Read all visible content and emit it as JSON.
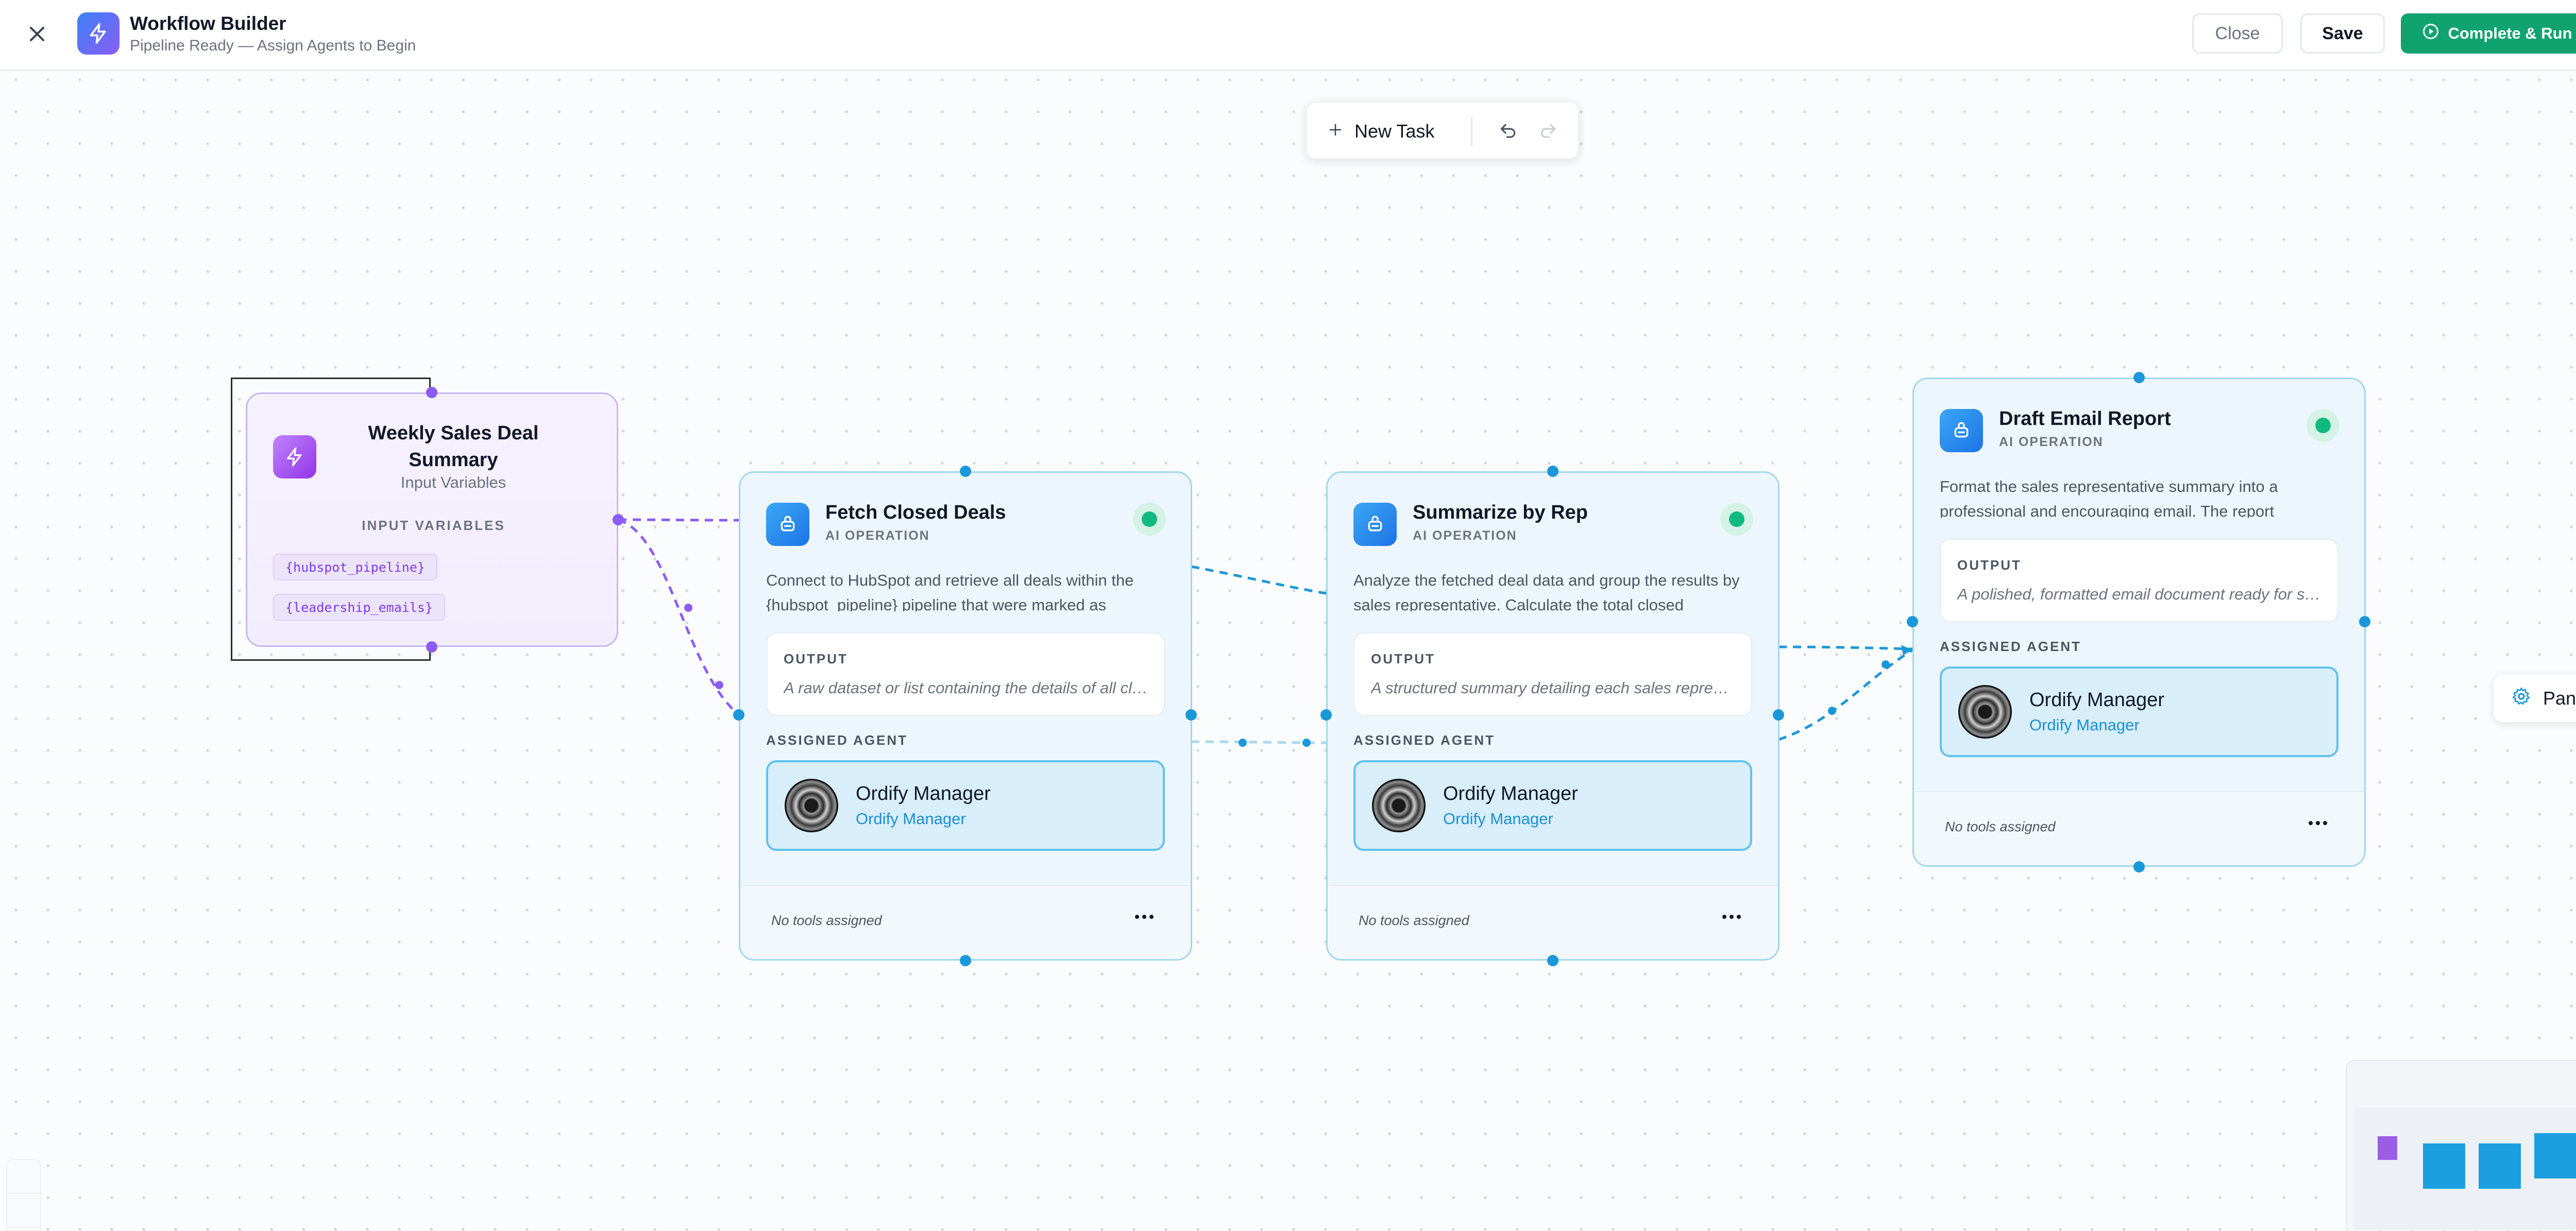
{
  "header": {
    "title": "Workflow Builder",
    "subtitle": "Pipeline Ready — Assign Agents to Begin",
    "close_label": "Close",
    "save_label": "Save",
    "run_label": "Complete & Run",
    "icons": {
      "close": "close-icon",
      "logo": "lightning-icon",
      "run": "play-circle-icon"
    }
  },
  "toolbar": {
    "new_task_label": "New Task",
    "icons": {
      "new_task": "plus-icon",
      "undo": "undo-icon",
      "redo": "redo-icon"
    }
  },
  "trigger": {
    "title": "Weekly Sales Deal Summary",
    "subtitle": "Input Variables",
    "variables_label": "INPUT VARIABLES",
    "variables": [
      "{hubspot_pipeline}",
      "{leadership_emails}"
    ]
  },
  "tasks": [
    {
      "title": "Fetch Closed Deals",
      "kind": "AI OPERATION",
      "description": "Connect to HubSpot and retrieve all deals within the {hubspot_pipeline} pipeline that were marked as",
      "output_label": "OUTPUT",
      "output": "A raw dataset or list containing the details of all closed deals",
      "agent_label": "ASSIGNED AGENT",
      "agent_name": "Ordify Manager",
      "agent_role": "Ordify Manager",
      "tools": "No tools assigned"
    },
    {
      "title": "Summarize by Rep",
      "kind": "AI OPERATION",
      "description": "Analyze the fetched deal data and group the results by sales representative. Calculate the total closed",
      "output_label": "OUTPUT",
      "output": "A structured summary detailing each sales representative",
      "agent_label": "ASSIGNED AGENT",
      "agent_name": "Ordify Manager",
      "agent_role": "Ordify Manager",
      "tools": "No tools assigned"
    },
    {
      "title": "Draft Email Report",
      "kind": "AI OPERATION",
      "description": "Format the sales representative summary into a professional and encouraging email. The report",
      "output_label": "OUTPUT",
      "output": "A polished, formatted email document ready for sending",
      "agent_label": "ASSIGNED AGENT",
      "agent_name": "Ordify Manager",
      "agent_role": "Ordify Manager",
      "tools": "No tools assigned"
    }
  ],
  "panel_button": {
    "label": "Panel",
    "icon": "gear-icon"
  },
  "colors": {
    "accent_green": "#10a36f",
    "task_border": "#9fd7f0",
    "trigger_border": "#c7b6f2",
    "edge_blue": "#1a98d9",
    "edge_purple": "#8b5cf6"
  }
}
